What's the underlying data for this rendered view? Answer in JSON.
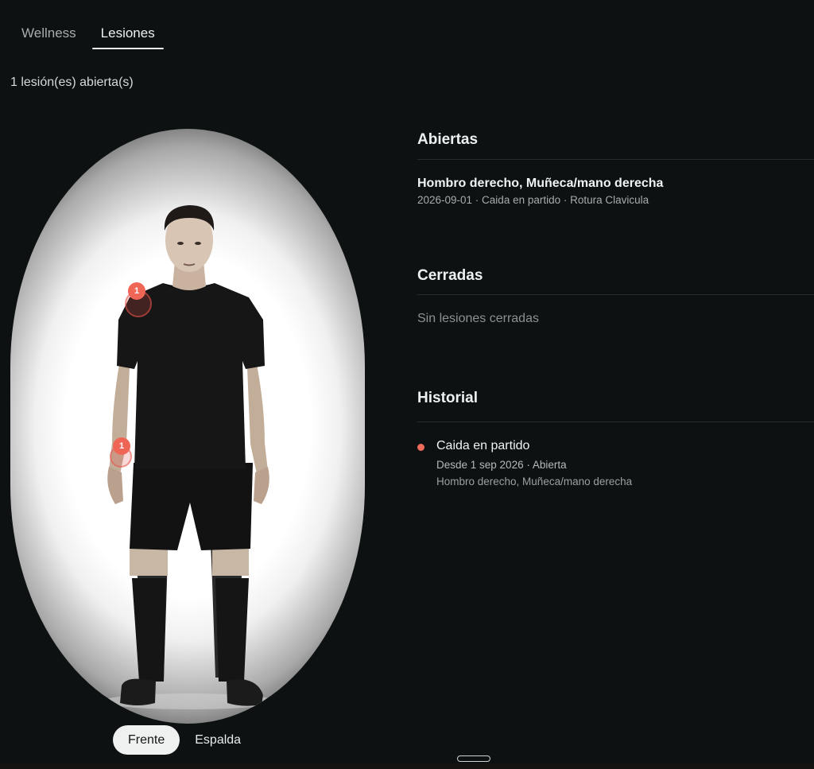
{
  "tabs": [
    {
      "label": "Wellness",
      "active": false
    },
    {
      "label": "Lesiones",
      "active": true
    }
  ],
  "summary": "1 lesión(es) abierta(s)",
  "body_map": {
    "markers": [
      {
        "count": "1",
        "area": "Hombro derecho"
      },
      {
        "count": "1",
        "area": "Muñeca/mano derecha"
      }
    ],
    "view_toggle": {
      "front": "Frente",
      "back": "Espalda",
      "selected": "Frente"
    }
  },
  "open_section": {
    "title": "Abiertas",
    "items": [
      {
        "title": "Hombro derecho, Muñeca/mano derecha",
        "meta": "2026-09-01 · Caida en partido · Rotura Clavicula"
      }
    ]
  },
  "closed_section": {
    "title": "Cerradas",
    "empty_text": "Sin lesiones cerradas"
  },
  "history_section": {
    "title": "Historial",
    "items": [
      {
        "title": "Caida en partido",
        "line1": "Desde 1 sep 2026 · Abierta",
        "line2": "Hombro derecho, Muñeca/mano derecha"
      }
    ]
  },
  "colors": {
    "background": "#0d1111",
    "accent": "#ef6556",
    "text_primary": "#eef1f1",
    "text_muted": "#a6acac"
  }
}
